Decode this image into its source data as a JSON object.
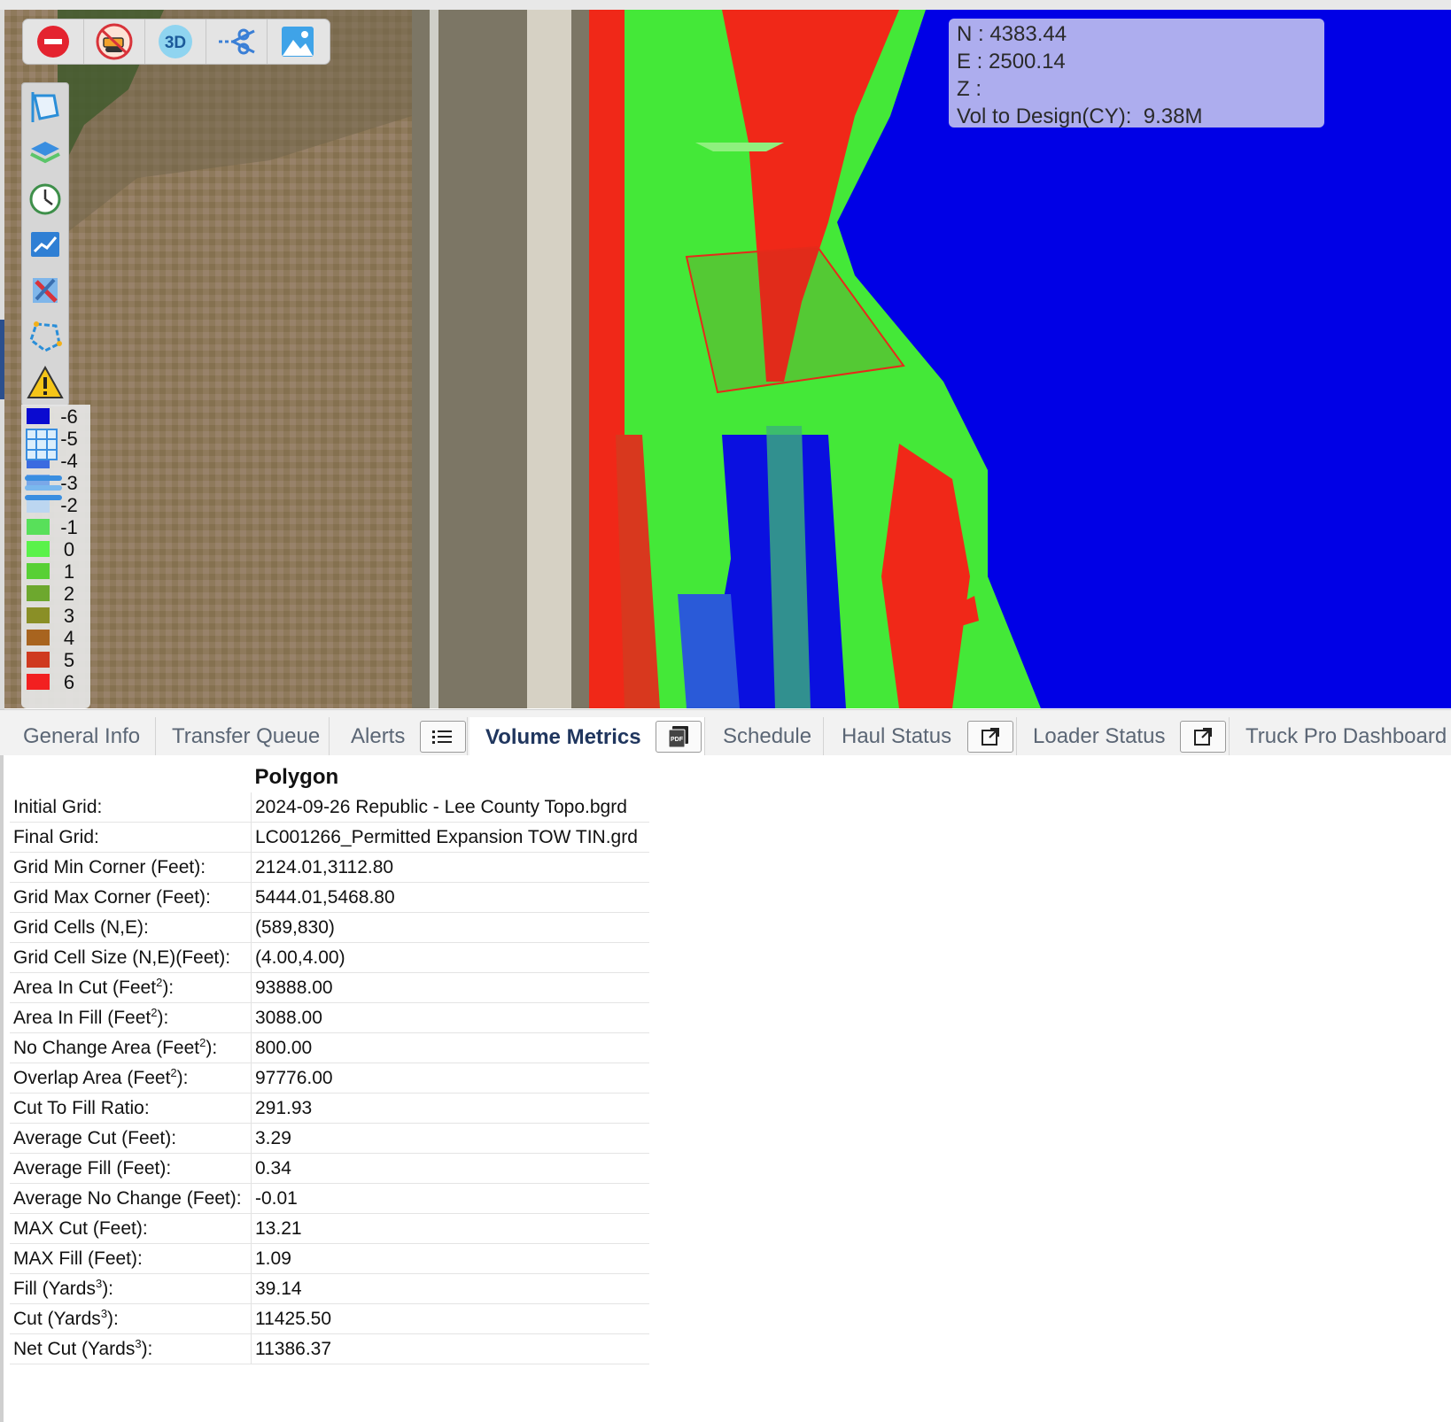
{
  "toolbar": {
    "items": [
      {
        "name": "stop-icon"
      },
      {
        "name": "bulldozer-disabled-icon"
      },
      {
        "name": "view-3d-icon",
        "label": "3D"
      },
      {
        "name": "cut-line-icon"
      },
      {
        "name": "image-icon"
      }
    ]
  },
  "sidebar": {
    "items": [
      "polygon-select-icon",
      "layers-icon",
      "history-clock-icon",
      "chart-icon",
      "tools-icon",
      "draw-polygon-icon",
      "warning-icon",
      "grid-icon",
      "lines-icon"
    ]
  },
  "legend": {
    "entries": [
      {
        "label": "-6",
        "color": "#0a0ad0"
      },
      {
        "label": "-5",
        "color": "#1a2fd8"
      },
      {
        "label": "-4",
        "color": "#3b6be0"
      },
      {
        "label": "-3",
        "color": "#7aa8e8"
      },
      {
        "label": "-2",
        "color": "#bcd6f0"
      },
      {
        "label": "-1",
        "color": "#58e05a"
      },
      {
        "label": "0",
        "color": "#5af24a"
      },
      {
        "label": "1",
        "color": "#58d035"
      },
      {
        "label": "2",
        "color": "#6da82e"
      },
      {
        "label": "3",
        "color": "#8a8f26"
      },
      {
        "label": "4",
        "color": "#a8641f"
      },
      {
        "label": "5",
        "color": "#cf3a1f"
      },
      {
        "label": "6",
        "color": "#f22020"
      }
    ]
  },
  "coords": {
    "n": "N : 4383.44",
    "e": "E : 2500.14",
    "z": "Z :",
    "vol_label": "Vol to Design(CY):",
    "vol_value": "9.38M"
  },
  "tabs": [
    {
      "label": "General Info"
    },
    {
      "label": "Transfer Queue"
    },
    {
      "label": "Alerts"
    },
    {
      "label": "Volume Metrics"
    },
    {
      "label": "Schedule"
    },
    {
      "label": "Haul Status"
    },
    {
      "label": "Loader Status"
    },
    {
      "label": "Truck Pro Dashboard"
    }
  ],
  "table": {
    "header": "Polygon",
    "rows": [
      {
        "key": "Initial Grid:",
        "value": "2024-09-26 Republic - Lee County Topo.bgrd"
      },
      {
        "key": "Final Grid:",
        "value": "LC001266_Permitted Expansion TOW TIN.grd"
      },
      {
        "key": "Grid Min Corner (Feet):",
        "value": "2124.01,3112.80"
      },
      {
        "key": "Grid Max Corner (Feet):",
        "value": "5444.01,5468.80"
      },
      {
        "key": "Grid Cells (N,E):",
        "value": "(589,830)"
      },
      {
        "key": "Grid Cell Size (N,E)(Feet):",
        "value": "(4.00,4.00)"
      },
      {
        "key": "Area In Cut (Feet",
        "sup": "2",
        "tail": "):",
        "value": "93888.00"
      },
      {
        "key": "Area In Fill (Feet",
        "sup": "2",
        "tail": "):",
        "value": "3088.00"
      },
      {
        "key": "No Change Area (Feet",
        "sup": "2",
        "tail": "):",
        "value": "800.00"
      },
      {
        "key": "Overlap Area (Feet",
        "sup": "2",
        "tail": "):",
        "value": "97776.00"
      },
      {
        "key": "Cut To Fill Ratio:",
        "value": "291.93"
      },
      {
        "key": "Average Cut (Feet):",
        "value": "3.29"
      },
      {
        "key": "Average Fill (Feet):",
        "value": "0.34"
      },
      {
        "key": "Average No Change (Feet):",
        "value": "-0.01"
      },
      {
        "key": "MAX Cut (Feet):",
        "value": "13.21"
      },
      {
        "key": "MAX Fill (Feet):",
        "value": "1.09"
      },
      {
        "key": "Fill (Yards",
        "sup": "3",
        "tail": "):",
        "value": "39.14"
      },
      {
        "key": "Cut (Yards",
        "sup": "3",
        "tail": "):",
        "value": "11425.50"
      },
      {
        "key": "Net Cut (Yards",
        "sup": "3",
        "tail": "):",
        "value": "11386.37"
      }
    ]
  }
}
